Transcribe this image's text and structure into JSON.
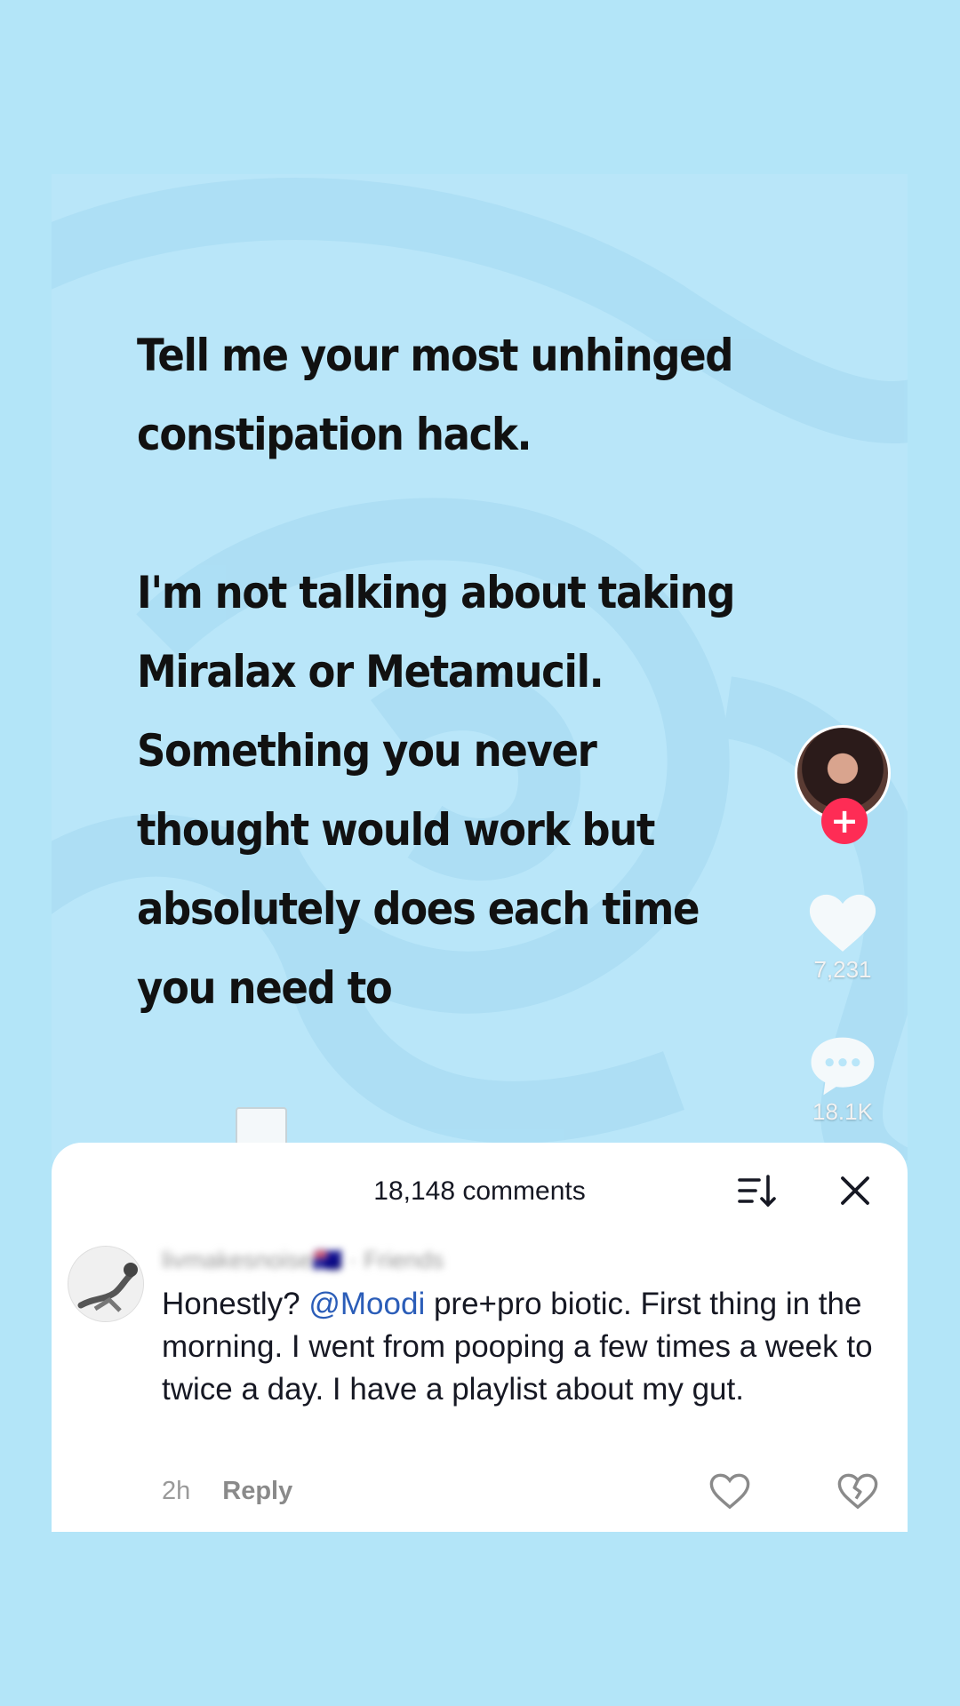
{
  "video": {
    "caption_lines": [
      "Tell me your most unhinged",
      "constipation hack.",
      "",
      "I'm not talking about taking",
      "Miralax or Metamucil.",
      "Something you never",
      "thought would work but",
      "absolutely does each time",
      "you need to"
    ]
  },
  "rail": {
    "follow_symbol": "+",
    "likes": "7,231",
    "comments": "18.1K"
  },
  "comments_sheet": {
    "title": "18,148 comments",
    "comment": {
      "username": "livmakesnoise🇦🇺 · Friends",
      "text_before": "Honestly? ",
      "mention": "@Moodi",
      "text_after": " pre+pro biotic. First thing in the morning. I went from pooping a few times a week to twice a day. I have a playlist about my gut.",
      "time": "2h",
      "reply_label": "Reply"
    }
  },
  "colors": {
    "background": "#b3e5f8",
    "follow_red": "#fe2c55",
    "mention_blue": "#2b5db8"
  },
  "icons": [
    "heart-icon",
    "comment-bubble-icon",
    "sort-icon",
    "close-icon",
    "comment-heart-icon",
    "dislike-icon"
  ]
}
